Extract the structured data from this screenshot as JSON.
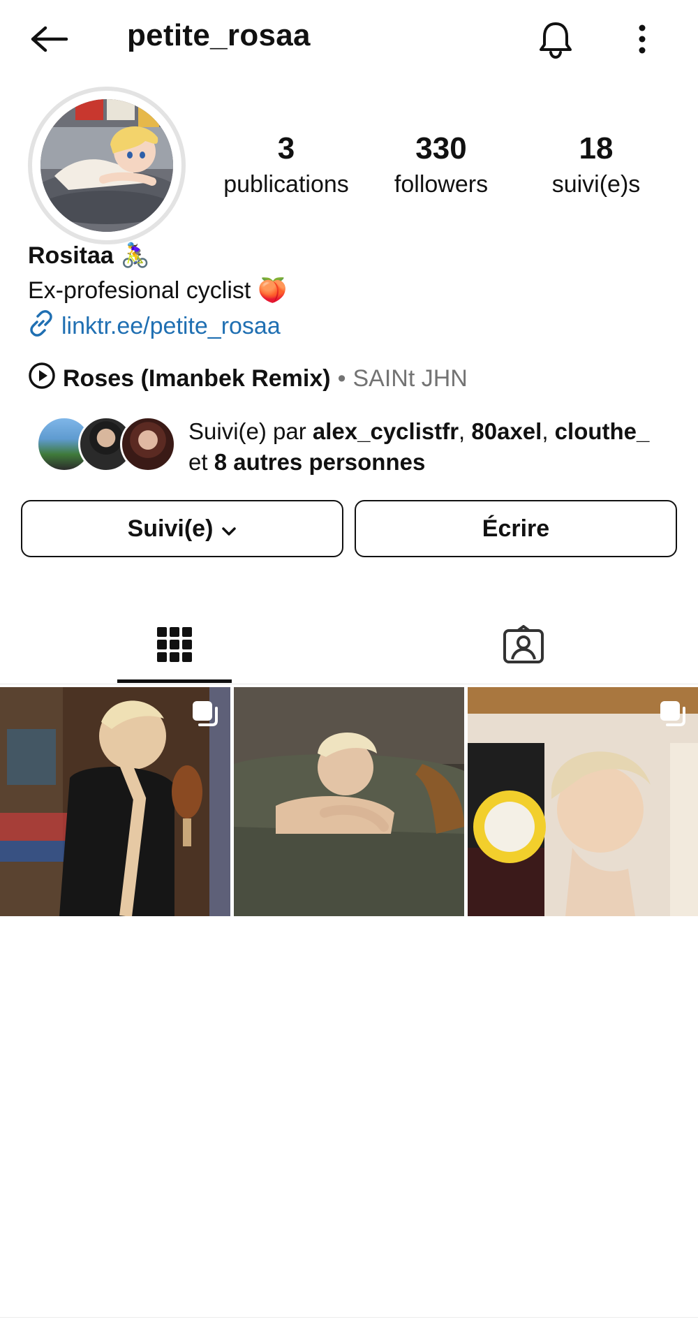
{
  "header": {
    "username": "petite_rosaa",
    "back_icon": "arrow-left-icon",
    "bell_icon": "bell-icon",
    "more_icon": "more-vertical-icon"
  },
  "stats": [
    {
      "value": "3",
      "label": "publications"
    },
    {
      "value": "330",
      "label": "followers"
    },
    {
      "value": "18",
      "label": "suivi(e)s"
    }
  ],
  "profile": {
    "name": "Rositaa",
    "name_emoji": "🚴‍♀️",
    "bio": "Ex-profesional cyclist",
    "bio_emoji": "🍑",
    "link": "linktr.ee/petite_rosaa"
  },
  "music": {
    "title": "Roses (Imanbek Remix)",
    "separator": "•",
    "artist": "SAINt JHN"
  },
  "followed_by": {
    "prefix": "Suivi(e) par ",
    "users": [
      "alex_cyclistfr",
      "80axel",
      "clouthe_"
    ],
    "comma": ", ",
    "and": "et ",
    "others": "8 autres personnes"
  },
  "buttons": {
    "follow_label": "Suivi(e)",
    "write_label": "Écrire"
  },
  "tabs": {
    "grid_icon": "grid-icon",
    "tagged_icon": "tagged-person-icon"
  },
  "colors": {
    "link": "#1f6fb2",
    "muted": "#737373"
  }
}
